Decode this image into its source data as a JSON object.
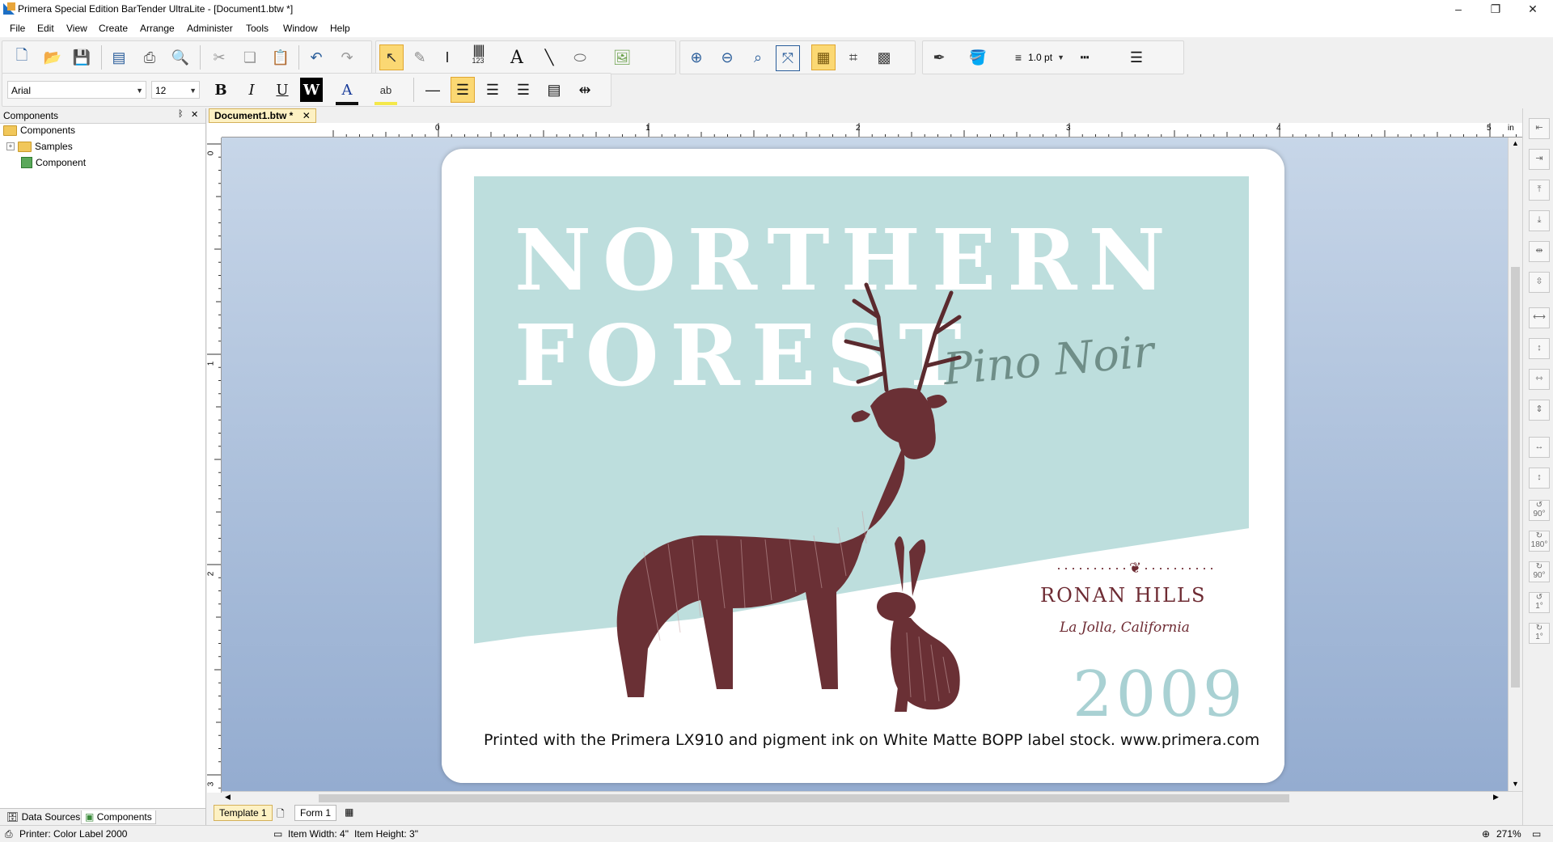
{
  "window": {
    "title": "Primera Special Edition BarTender UltraLite - [Document1.btw *]",
    "minimize": "–",
    "restore": "❐",
    "close": "✕"
  },
  "menu": [
    "File",
    "Edit",
    "View",
    "Create",
    "Arrange",
    "Administer",
    "Tools",
    "Window",
    "Help"
  ],
  "toolbar": {
    "font_name": "Arial",
    "font_size": "12",
    "line_width": "1.0 pt",
    "bold": "B",
    "italic": "I",
    "underline": "U",
    "reverse": "W",
    "text_tool": "A",
    "barcode_caption": "123",
    "highlight_caption": "ab"
  },
  "left_panel": {
    "title": "Components",
    "pin": "ᛒ",
    "close": "✕",
    "tree": [
      {
        "label": "Components",
        "level": 0
      },
      {
        "label": "Samples",
        "level": 1
      },
      {
        "label": "Component",
        "level": 1
      }
    ],
    "tabs": [
      "Data Sources",
      "Components"
    ]
  },
  "document_tab": {
    "label": "Document1.btw *",
    "close": "✕"
  },
  "ruler": {
    "h_ticks": [
      "0",
      "1",
      "2",
      "3",
      "4",
      "5"
    ],
    "v_ticks": [
      "0",
      "1",
      "2",
      "3"
    ],
    "unit": "in"
  },
  "label": {
    "headline_line1": "NORTHERN",
    "headline_line2": "FOREST",
    "varietal": "Pino Noir",
    "winery_ornament": "··········❦··········",
    "winery": "RONAN HILLS",
    "town": "La Jolla, California",
    "vintage": "2009",
    "footer": "Printed with the Primera LX910 and pigment ink on White Matte BOPP label stock. www.primera.com"
  },
  "page_tabs": [
    "Template 1",
    "Form 1"
  ],
  "right_toolbar": {
    "rotate_labels": [
      "90°",
      "180°",
      "90°",
      "1°",
      "1°"
    ]
  },
  "status": {
    "printer": "Printer: Color Label 2000",
    "item_width": "Item Width: 4\"",
    "item_height": "Item Height: 3\"",
    "zoom": "271%"
  },
  "colors": {
    "label_teal": "#bddedd",
    "ink_maroon": "#6e2b33",
    "canvas_top": "#c7d6e8",
    "canvas_bottom": "#94acd0",
    "active_tool": "#fbd873"
  }
}
